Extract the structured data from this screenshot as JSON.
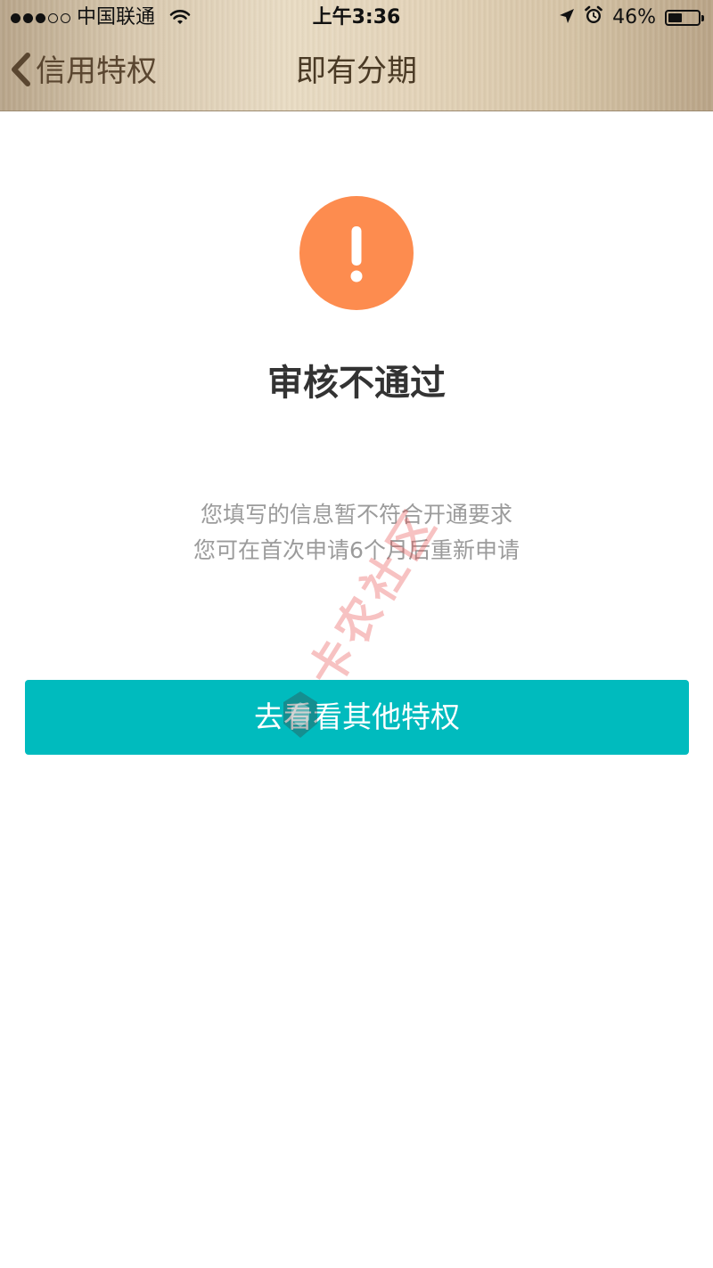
{
  "status_bar": {
    "carrier": "中国联通",
    "time": "上午3:36",
    "battery_percent": "46%",
    "battery_level": 0.46,
    "signal_bars_filled": 3,
    "signal_bars_total": 5
  },
  "nav": {
    "back_label": "信用特权",
    "title": "即有分期"
  },
  "result": {
    "icon": "exclamation-icon",
    "icon_color": "#fd8c4f",
    "title": "审核不通过",
    "description_line1": "您填写的信息暂不符合开通要求",
    "description_line2": "您可在首次申请6个月后重新申请"
  },
  "actions": {
    "primary_label": "去看看其他特权",
    "primary_color": "#00bbbe"
  },
  "watermark": {
    "text": "卡农社区"
  }
}
